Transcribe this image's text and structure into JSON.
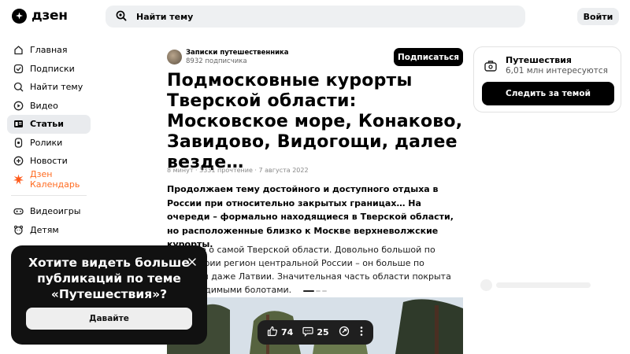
{
  "header": {
    "logo_text": "дзен",
    "search_placeholder": "Найти тему",
    "login_label": "Войти"
  },
  "sidebar": {
    "items": [
      {
        "label": "Главная",
        "icon": "home-icon"
      },
      {
        "label": "Подписки",
        "icon": "subscriptions-icon"
      },
      {
        "label": "Найти тему",
        "icon": "search-topic-icon"
      },
      {
        "label": "Видео",
        "icon": "video-icon"
      },
      {
        "label": "Статьи",
        "icon": "articles-icon",
        "active": true
      },
      {
        "label": "Ролики",
        "icon": "shorts-icon"
      },
      {
        "label": "Новости",
        "icon": "news-icon"
      },
      {
        "label": "Дзен Календарь",
        "icon": "calendar-burst-icon"
      },
      {
        "label": "Видеоигры",
        "icon": "gamepad-icon"
      },
      {
        "label": "Детям",
        "icon": "kids-icon"
      }
    ]
  },
  "article": {
    "author_name": "Записки путешественника",
    "author_subs": "8932 подписчика",
    "subscribe_label": "Подписаться",
    "title": "Подмосковные курорты Тверской области: Московское море, Конаково, Завидово, Видогощи, далее везде…",
    "meta": "8 минут · 3331 прочтение · 7 августа 2022",
    "lead": "Продолжаем тему достойного и доступного отдыха в России при относительно закрытых границах… На очереди – формально находящиеся в Тверской области, но расположенные близко к Москве верхневолжские курорты.",
    "body": "Немного о самой Тверской области. Довольно большой по территории регион центральной России – он больше по площади даже Латвии. Значительная часть области покрыта непроходимыми болотами."
  },
  "actions": {
    "likes": "74",
    "comments": "25"
  },
  "topic": {
    "name": "Путешествия",
    "subscribers": "6,01 млн интересуются",
    "follow_label": "Следить за темой"
  },
  "popup": {
    "title": "Хотите видеть больше публикаций по теме «Путешествия»?",
    "button_label": "Давайте"
  },
  "colors": {
    "accent": "#ff6a1f",
    "dark": "#111111",
    "active_nav": "#e9ebee"
  }
}
